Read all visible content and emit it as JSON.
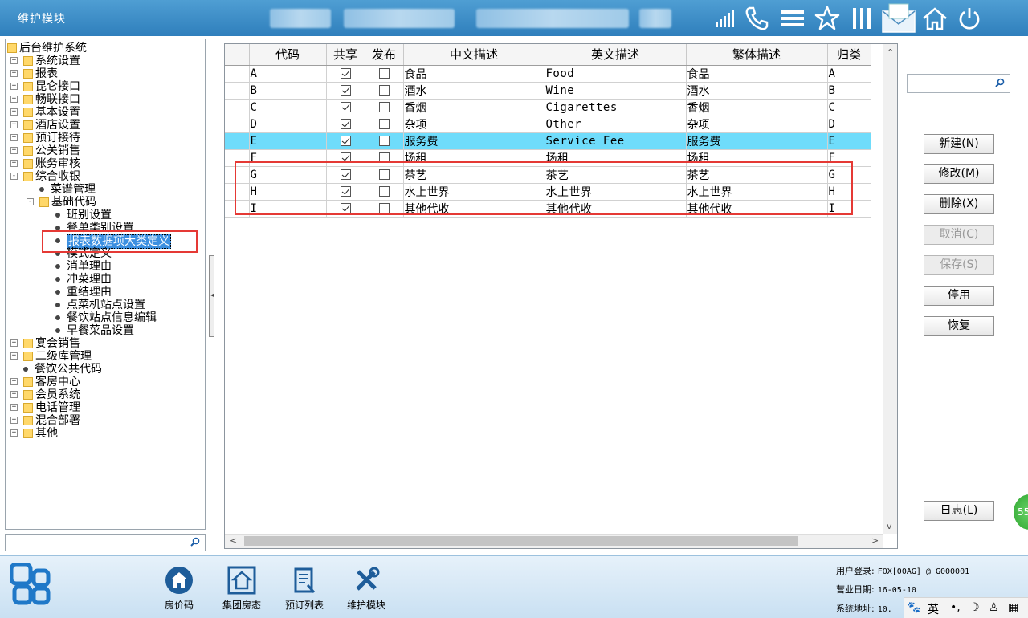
{
  "header": {
    "title": "维护模块",
    "icons": [
      "signal-icon",
      "phone-icon",
      "menu-icon",
      "star-icon",
      "bars-icon",
      "mail-icon",
      "home-icon",
      "power-icon"
    ]
  },
  "tree": {
    "root": "后台维护系统",
    "items": [
      {
        "label": "系统设置",
        "type": "folder",
        "level": 1
      },
      {
        "label": "报表",
        "type": "folder",
        "level": 1
      },
      {
        "label": "昆仑接口",
        "type": "folder",
        "level": 1
      },
      {
        "label": "畅联接口",
        "type": "folder",
        "level": 1
      },
      {
        "label": "基本设置",
        "type": "folder",
        "level": 1
      },
      {
        "label": "酒店设置",
        "type": "folder",
        "level": 1
      },
      {
        "label": "预订接待",
        "type": "folder",
        "level": 1
      },
      {
        "label": "公关销售",
        "type": "folder",
        "level": 1
      },
      {
        "label": "账务审核",
        "type": "folder",
        "level": 1
      },
      {
        "label": "综合收银",
        "type": "folder",
        "level": 1,
        "expanded": true
      },
      {
        "label": "菜谱管理",
        "type": "leaf",
        "level": 2
      },
      {
        "label": "基础代码",
        "type": "folder",
        "level": 2,
        "expanded": true
      },
      {
        "label": "班别设置",
        "type": "leaf",
        "level": 3
      },
      {
        "label": "餐单类别设置",
        "type": "leaf",
        "level": 3
      },
      {
        "label": "报表数据项大类定义",
        "type": "leaf",
        "level": 3,
        "selected": true
      },
      {
        "label": "模式定义",
        "type": "leaf",
        "level": 3
      },
      {
        "label": "消单理由",
        "type": "leaf",
        "level": 3
      },
      {
        "label": "冲菜理由",
        "type": "leaf",
        "level": 3
      },
      {
        "label": "重结理由",
        "type": "leaf",
        "level": 3
      },
      {
        "label": "点菜机站点设置",
        "type": "leaf",
        "level": 3
      },
      {
        "label": "餐饮站点信息编辑",
        "type": "leaf",
        "level": 3
      },
      {
        "label": "早餐菜品设置",
        "type": "leaf",
        "level": 3
      },
      {
        "label": "宴会销售",
        "type": "folder",
        "level": 1
      },
      {
        "label": "二级库管理",
        "type": "folder",
        "level": 1
      },
      {
        "label": "餐饮公共代码",
        "type": "leaf",
        "level": 1
      },
      {
        "label": "客房中心",
        "type": "folder",
        "level": 1
      },
      {
        "label": "会员系统",
        "type": "folder",
        "level": 1
      },
      {
        "label": "电话管理",
        "type": "folder",
        "level": 1
      },
      {
        "label": "混合部署",
        "type": "folder",
        "level": 1
      },
      {
        "label": "其他",
        "type": "folder",
        "level": 1
      }
    ]
  },
  "grid": {
    "columns": [
      "代码",
      "共享",
      "发布",
      "中文描述",
      "英文描述",
      "繁体描述",
      "归类"
    ],
    "rows": [
      {
        "code": "A",
        "shared": true,
        "published": false,
        "zh": "食品",
        "en": "Food",
        "tw": "食品",
        "cat": "A"
      },
      {
        "code": "B",
        "shared": true,
        "published": false,
        "zh": "酒水",
        "en": "Wine",
        "tw": "酒水",
        "cat": "B"
      },
      {
        "code": "C",
        "shared": true,
        "published": false,
        "zh": "香烟",
        "en": "Cigarettes",
        "tw": "香烟",
        "cat": "C"
      },
      {
        "code": "D",
        "shared": true,
        "published": false,
        "zh": "杂项",
        "en": "Other",
        "tw": "杂项",
        "cat": "D"
      },
      {
        "code": "E",
        "shared": true,
        "published": false,
        "zh": "服务费",
        "en": "Service Fee",
        "tw": "服务费",
        "cat": "E",
        "selected": true
      },
      {
        "code": "F",
        "shared": true,
        "published": false,
        "zh": "场租",
        "en": "场租",
        "tw": "场租",
        "cat": "F"
      },
      {
        "code": "G",
        "shared": true,
        "published": false,
        "zh": "茶艺",
        "en": "茶艺",
        "tw": "茶艺",
        "cat": "G"
      },
      {
        "code": "H",
        "shared": true,
        "published": false,
        "zh": "水上世界",
        "en": "水上世界",
        "tw": "水上世界",
        "cat": "H"
      },
      {
        "code": "I",
        "shared": true,
        "published": false,
        "zh": "其他代收",
        "en": "其他代收",
        "tw": "其他代收",
        "cat": "I"
      }
    ]
  },
  "buttons": {
    "new": "新建(N)",
    "edit": "修改(M)",
    "delete": "删除(X)",
    "cancel": "取消(C)",
    "save": "保存(S)",
    "disable": "停用",
    "restore": "恢复",
    "log": "日志(L)"
  },
  "badge": "55",
  "footer": {
    "tools": [
      {
        "label": "房价码",
        "icon": "home-circle-icon"
      },
      {
        "label": "集团房态",
        "icon": "house-frame-icon"
      },
      {
        "label": "预订列表",
        "icon": "clipboard-icon"
      },
      {
        "label": "维护模块",
        "icon": "tools-icon"
      }
    ],
    "login_label": "用户登录:",
    "login_value": "FOX[00AG] @ G000001",
    "date_label": "营业日期:",
    "date_value": "16-05-10",
    "addr_label": "系统地址:",
    "addr_value": "10.",
    "ime": "英"
  },
  "colors": {
    "header": "#3a8bc8",
    "selected_row": "#6fdcfb",
    "highlight_box": "#e53935",
    "tree_selected": "#3b8fe0"
  }
}
